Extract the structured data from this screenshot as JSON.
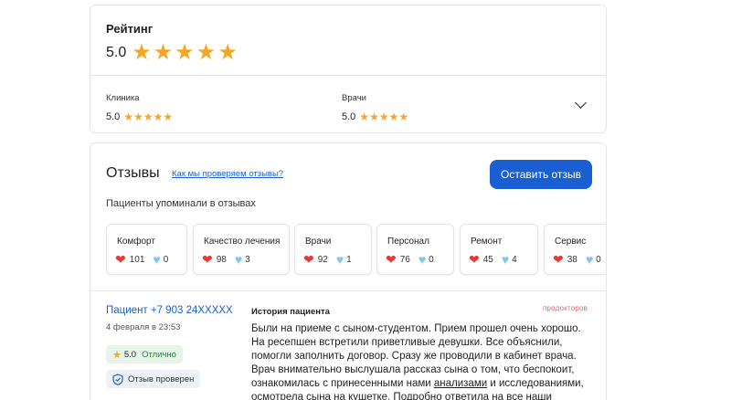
{
  "rating": {
    "title": "Рейтинг",
    "value": "5.0",
    "stars": 5,
    "sub": [
      {
        "label": "Клиника",
        "value": "5.0",
        "stars": 5
      },
      {
        "label": "Врачи",
        "value": "5.0",
        "stars": 5
      }
    ],
    "star_color": "#f5a623"
  },
  "reviews": {
    "title": "Отзывы",
    "verify_link": "Как мы проверяем отзывы?",
    "leave_button": "Оставить отзыв",
    "mentions_title": "Пациенты упоминали в отзывах",
    "accent": "#1a5fd1",
    "tags": [
      {
        "name": "Комфорт",
        "likes": "101",
        "dislikes": "0"
      },
      {
        "name": "Качество лечения",
        "likes": "98",
        "dislikes": "3"
      },
      {
        "name": "Врачи",
        "likes": "92",
        "dislikes": "1"
      },
      {
        "name": "Персонал",
        "likes": "76",
        "dislikes": "0"
      },
      {
        "name": "Ремонт",
        "likes": "45",
        "dislikes": "4"
      },
      {
        "name": "Сервис",
        "likes": "38",
        "dislikes": "0"
      }
    ],
    "review": {
      "author": "Пациент +7 903 24XXXXX",
      "date": "4 февраля в 23:53",
      "score": "5.0",
      "score_label": "Отлично",
      "verified": "Отзыв проверен",
      "section": "История пациента",
      "source": "продокторов",
      "text_1": "Были на приеме с сыном-студентом. Прием прошел очень хорошо. На ресепшен встретили приветливые девушки. Все объяснили, помогли заполнить договор. Сразу же проводили в кабинет врача. Врач внимательно выслушала рассказ сына о том, что беспокоит, ознакомилась с принесенными нами ",
      "text_link": "анализами",
      "text_2": " и исследованиями, осмотрела сына на кушетке. Подробно ответила на все наши вопросы. Дала рекомендации по дальнейшему лечению."
    }
  }
}
